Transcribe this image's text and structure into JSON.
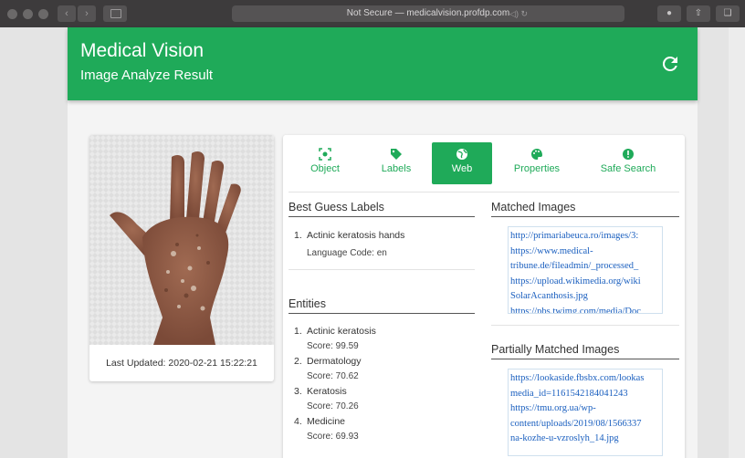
{
  "browser": {
    "address": "Not Secure — medicalvision.profdp.com"
  },
  "header": {
    "title": "Medical Vision",
    "subtitle": "Image Analyze Result"
  },
  "image_card": {
    "last_updated": "Last Updated: 2020-02-21 15:22:21"
  },
  "tabs": [
    {
      "label": "Object",
      "icon": "object-detect-icon"
    },
    {
      "label": "Labels",
      "icon": "tag-icon"
    },
    {
      "label": "Web",
      "icon": "globe-icon",
      "active": true
    },
    {
      "label": "Properties",
      "icon": "palette-icon"
    },
    {
      "label": "Safe Search",
      "icon": "alert-icon"
    }
  ],
  "best_guess": {
    "title": "Best Guess Labels",
    "items": [
      {
        "num": "1.",
        "label": "Actinic keratosis hands",
        "language": "Language Code: en"
      }
    ]
  },
  "entities": {
    "title": "Entities",
    "items": [
      {
        "num": "1.",
        "label": "Actinic keratosis",
        "score": "Score: 99.59"
      },
      {
        "num": "2.",
        "label": "Dermatology",
        "score": "Score: 70.62"
      },
      {
        "num": "3.",
        "label": "Keratosis",
        "score": "Score: 70.26"
      },
      {
        "num": "4.",
        "label": "Medicine",
        "score": "Score: 69.93"
      }
    ]
  },
  "matched_images": {
    "title": "Matched Images",
    "links": [
      "http://primariabeuca.ro/images/3:",
      "https://www.medical-",
      "tribune.de/fileadmin/_processed_",
      "https://upload.wikimedia.org/wiki",
      "SolarAcanthosis.jpg",
      "https://pbs.twimg.com/media/Doc"
    ]
  },
  "partially_matched": {
    "title": "Partially Matched Images",
    "links": [
      "https://lookaside.fbsbx.com/lookas",
      "media_id=1161542184041243",
      "https://tmu.org.ua/wp-",
      "content/uploads/2019/08/1566337",
      "na-kozhe-u-vzroslyh_14.jpg"
    ]
  },
  "colors": {
    "accent": "#1faa59",
    "link": "#1a5fbf"
  }
}
